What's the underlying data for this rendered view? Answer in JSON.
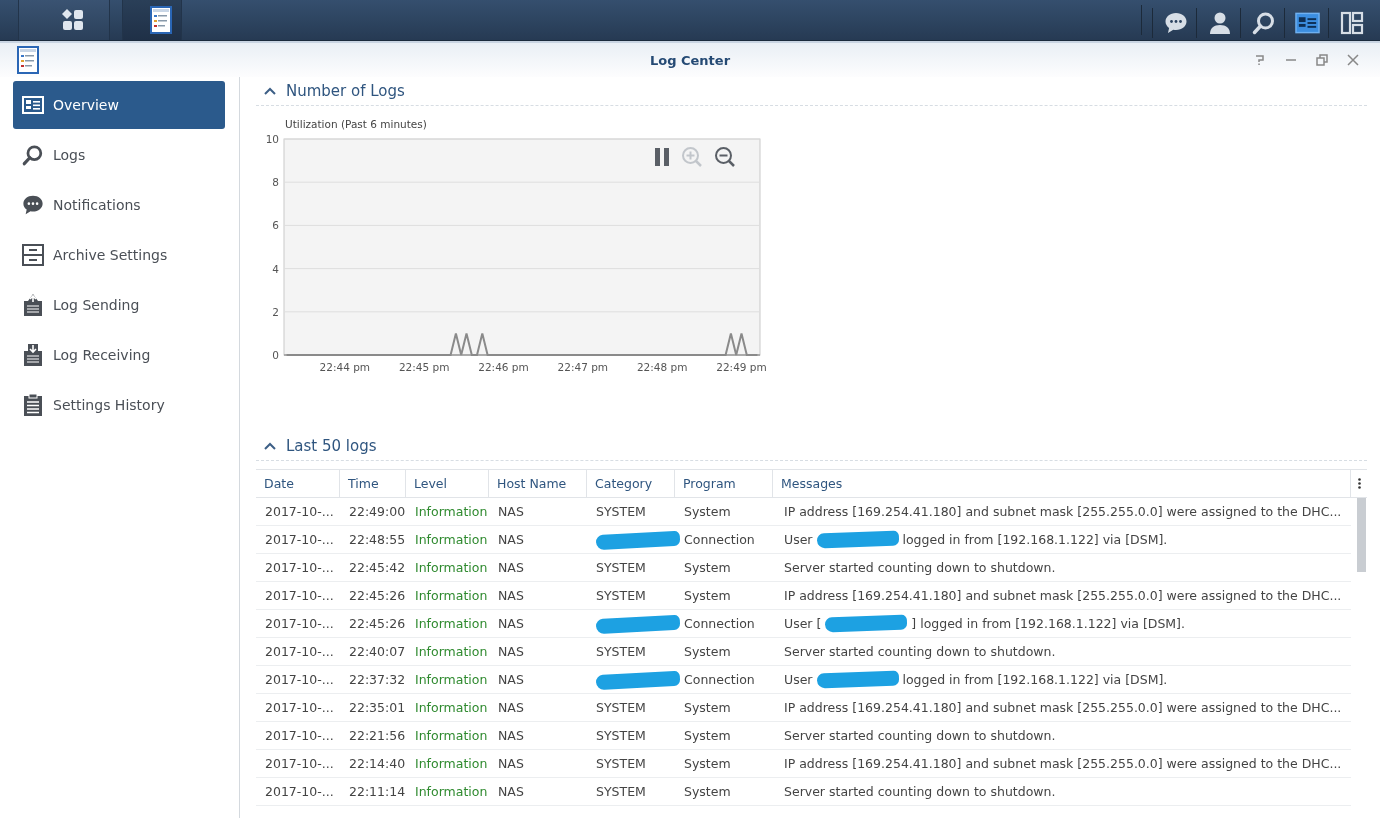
{
  "taskbar": {
    "left": [
      {
        "kind": "main-menu",
        "selected": false
      },
      {
        "kind": "log-center",
        "selected": true
      }
    ],
    "right": [
      {
        "kind": "chat",
        "selected": false
      },
      {
        "kind": "user",
        "selected": false
      },
      {
        "kind": "search",
        "selected": false
      },
      {
        "kind": "widgets",
        "selected": true
      },
      {
        "kind": "windows",
        "selected": false
      }
    ]
  },
  "window": {
    "title": "Log Center",
    "controls": [
      {
        "kind": "help"
      },
      {
        "kind": "minimize"
      },
      {
        "kind": "restore"
      },
      {
        "kind": "close"
      }
    ]
  },
  "sidebar": {
    "items": [
      {
        "label": "Overview",
        "kind": "overview",
        "selected": true
      },
      {
        "label": "Logs",
        "kind": "search",
        "selected": false
      },
      {
        "label": "Notifications",
        "kind": "chat",
        "selected": false
      },
      {
        "label": "Archive Settings",
        "kind": "cabinet",
        "selected": false
      },
      {
        "label": "Log Sending",
        "kind": "upload",
        "selected": false
      },
      {
        "label": "Log Receiving",
        "kind": "download",
        "selected": false
      },
      {
        "label": "Settings History",
        "kind": "clipboard",
        "selected": false
      }
    ]
  },
  "number_of_logs": {
    "title": "Number of Logs",
    "expanded": true,
    "tools": [
      {
        "kind": "pause",
        "disabled": false
      },
      {
        "kind": "zoom-in",
        "disabled": true
      },
      {
        "kind": "zoom-out",
        "disabled": false
      }
    ],
    "chart_data": {
      "type": "line",
      "title": "Utilization (Past 6 minutes)",
      "categories": [
        null,
        null,
        null,
        null,
        null,
        null,
        null,
        null,
        null,
        null,
        null,
        "22:44 pm",
        null,
        null,
        null,
        null,
        null,
        null,
        null,
        null,
        null,
        null,
        null,
        null,
        null,
        null,
        "22:45 pm",
        null,
        null,
        null,
        null,
        null,
        null,
        null,
        null,
        null,
        null,
        null,
        null,
        null,
        null,
        "22:46 pm",
        null,
        null,
        null,
        null,
        null,
        null,
        null,
        null,
        null,
        null,
        null,
        null,
        null,
        null,
        "22:47 pm",
        null,
        null,
        null,
        null,
        null,
        null,
        null,
        null,
        null,
        null,
        null,
        null,
        null,
        null,
        "22:48 pm",
        null,
        null,
        null,
        null,
        null,
        null,
        null,
        null,
        null,
        null,
        null,
        null,
        null,
        null,
        "22:49 pm",
        null,
        null,
        null
      ],
      "series": [
        {
          "color": "#8a8a8a",
          "values": [
            0,
            0,
            0,
            0,
            0,
            0,
            0,
            0,
            0,
            0,
            0,
            0,
            0,
            0,
            0,
            0,
            0,
            0,
            0,
            0,
            0,
            0,
            0,
            0,
            0,
            0,
            0,
            0,
            0,
            0,
            0,
            0,
            1,
            0,
            1,
            0,
            0,
            1,
            0,
            0,
            0,
            0,
            0,
            0,
            0,
            0,
            0,
            0,
            0,
            0,
            0,
            0,
            0,
            0,
            0,
            0,
            0,
            0,
            0,
            0,
            0,
            0,
            0,
            0,
            0,
            0,
            0,
            0,
            0,
            0,
            0,
            0,
            0,
            0,
            0,
            0,
            0,
            0,
            0,
            0,
            0,
            0,
            0,
            0,
            1,
            0,
            1,
            0,
            0,
            0
          ]
        }
      ],
      "ylim": [
        0,
        10
      ],
      "grid": true,
      "yticks": [
        0,
        2,
        4,
        6,
        8,
        10
      ]
    }
  },
  "last_logs": {
    "title": "Last 50 logs",
    "expanded": true,
    "columns": [
      "Date",
      "Time",
      "Level",
      "Host Name",
      "Category",
      "Program",
      "Messages"
    ],
    "rows": [
      {
        "date": "2017-10-...",
        "time": "22:49:00",
        "level": "Information",
        "host": "NAS",
        "category": "SYSTEM",
        "category_redacted": false,
        "program": "System",
        "message": "IP address [169.254.41.180] and subnet mask [255.255.0.0] were assigned to the DHC..."
      },
      {
        "date": "2017-10-...",
        "time": "22:48:55",
        "level": "Information",
        "host": "NAS",
        "category_redacted": true,
        "program": "Connection",
        "message_parts": [
          {
            "kind": "text",
            "text": "User"
          },
          {
            "kind": "redaction"
          },
          {
            "kind": "text",
            "text": "logged in from [192.168.1.122] via [DSM]."
          }
        ]
      },
      {
        "date": "2017-10-...",
        "time": "22:45:42",
        "level": "Information",
        "host": "NAS",
        "category": "SYSTEM",
        "category_redacted": false,
        "program": "System",
        "message": "Server started counting down to shutdown."
      },
      {
        "date": "2017-10-...",
        "time": "22:45:26",
        "level": "Information",
        "host": "NAS",
        "category": "SYSTEM",
        "category_redacted": false,
        "program": "System",
        "message": "IP address [169.254.41.180] and subnet mask [255.255.0.0] were assigned to the DHC..."
      },
      {
        "date": "2017-10-...",
        "time": "22:45:26",
        "level": "Information",
        "host": "NAS",
        "category_redacted": true,
        "program": "Connection",
        "message_parts": [
          {
            "kind": "text",
            "text": "User ["
          },
          {
            "kind": "redaction"
          },
          {
            "kind": "text",
            "text": "] logged in from [192.168.1.122] via [DSM]."
          }
        ]
      },
      {
        "date": "2017-10-...",
        "time": "22:40:07",
        "level": "Information",
        "host": "NAS",
        "category": "SYSTEM",
        "category_redacted": false,
        "program": "System",
        "message": "Server started counting down to shutdown."
      },
      {
        "date": "2017-10-...",
        "time": "22:37:32",
        "level": "Information",
        "host": "NAS",
        "category_redacted": true,
        "program": "Connection",
        "message_parts": [
          {
            "kind": "text",
            "text": "User"
          },
          {
            "kind": "redaction"
          },
          {
            "kind": "text",
            "text": "logged in from [192.168.1.122] via [DSM]."
          }
        ]
      },
      {
        "date": "2017-10-...",
        "time": "22:35:01",
        "level": "Information",
        "host": "NAS",
        "category": "SYSTEM",
        "category_redacted": false,
        "program": "System",
        "message": "IP address [169.254.41.180] and subnet mask [255.255.0.0] were assigned to the DHC..."
      },
      {
        "date": "2017-10-...",
        "time": "22:21:56",
        "level": "Information",
        "host": "NAS",
        "category": "SYSTEM",
        "category_redacted": false,
        "program": "System",
        "message": "Server started counting down to shutdown."
      },
      {
        "date": "2017-10-...",
        "time": "22:14:40",
        "level": "Information",
        "host": "NAS",
        "category": "SYSTEM",
        "category_redacted": false,
        "program": "System",
        "message": "IP address [169.254.41.180] and subnet mask [255.255.0.0] were assigned to the DHC..."
      },
      {
        "date": "2017-10-...",
        "time": "22:11:14",
        "level": "Information",
        "host": "NAS",
        "category": "SYSTEM",
        "category_redacted": false,
        "program": "System",
        "message": "Server started counting down to shutdown."
      }
    ]
  }
}
